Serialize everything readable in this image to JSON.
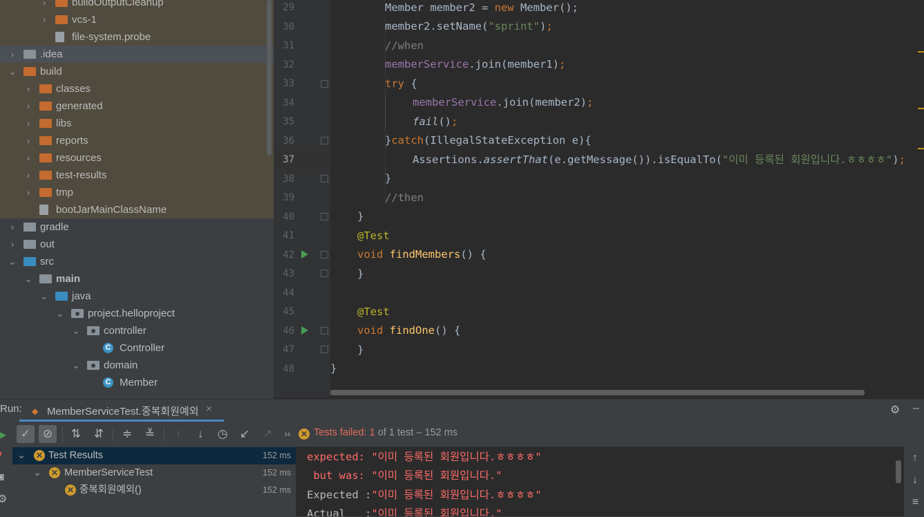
{
  "project_tree": {
    "items": [
      {
        "label": "buildOutputCleanup",
        "arrow": "›",
        "icon": "folder-orange"
      },
      {
        "label": "vcs-1",
        "arrow": "›",
        "icon": "folder-orange"
      },
      {
        "label": "file-system.probe",
        "arrow": "",
        "icon": "file"
      },
      {
        "label": ".idea",
        "arrow": "›",
        "icon": "folder-grey"
      },
      {
        "label": "build",
        "arrow": "⌄",
        "icon": "folder-orange"
      },
      {
        "label": "classes",
        "arrow": "›",
        "icon": "folder-orange"
      },
      {
        "label": "generated",
        "arrow": "›",
        "icon": "folder-orange"
      },
      {
        "label": "libs",
        "arrow": "›",
        "icon": "folder-orange"
      },
      {
        "label": "reports",
        "arrow": "›",
        "icon": "folder-orange"
      },
      {
        "label": "resources",
        "arrow": "›",
        "icon": "folder-orange"
      },
      {
        "label": "test-results",
        "arrow": "›",
        "icon": "folder-orange"
      },
      {
        "label": "tmp",
        "arrow": "›",
        "icon": "folder-orange"
      },
      {
        "label": "bootJarMainClassName",
        "arrow": "",
        "icon": "file"
      },
      {
        "label": "gradle",
        "arrow": "›",
        "icon": "folder-grey"
      },
      {
        "label": "out",
        "arrow": "›",
        "icon": "folder-grey"
      },
      {
        "label": "src",
        "arrow": "⌄",
        "icon": "folder-blue"
      },
      {
        "label": "main",
        "arrow": "⌄",
        "icon": "folder-grey"
      },
      {
        "label": "java",
        "arrow": "⌄",
        "icon": "folder-blue"
      },
      {
        "label": "project.helloproject",
        "arrow": "⌄",
        "icon": "package"
      },
      {
        "label": "controller",
        "arrow": "⌄",
        "icon": "package"
      },
      {
        "label": "Controller",
        "arrow": "",
        "icon": "class"
      },
      {
        "label": "domain",
        "arrow": "⌄",
        "icon": "package"
      },
      {
        "label": "Member",
        "arrow": "",
        "icon": "class"
      }
    ]
  },
  "editor": {
    "line_numbers": [
      "29",
      "30",
      "31",
      "32",
      "33",
      "34",
      "35",
      "36",
      "37",
      "38",
      "39",
      "40",
      "41",
      "42",
      "43",
      "44",
      "45",
      "46",
      "47",
      "48"
    ],
    "current_line": "37"
  },
  "run_panel": {
    "label": "Run:",
    "tab_label": "MemberServiceTest.중복회원예외",
    "tab_close": "×",
    "status_failed": "Tests failed:",
    "status_count": "1",
    "status_rest": "of 1 test – 152 ms",
    "results": [
      {
        "label": "Test Results",
        "time": "152 ms"
      },
      {
        "label": "MemberServiceTest",
        "time": "152 ms"
      },
      {
        "label": "중복회원예외()",
        "time": "152 ms"
      }
    ],
    "output": [
      "expected: \"이미 등록된 회원입니다.ㅎㅎㅎㅎ\"",
      " but was: \"이미 등록된 회원입니다.\"",
      "Expected :\"이미 등록된 회원입니다.ㅎㅎㅎㅎ\"",
      "Actual   :\"이미 등록된 회원입니다.\""
    ]
  },
  "colors": {
    "keyword": "#cc7832",
    "string": "#6a8759",
    "comment": "#808080",
    "field": "#9876aa",
    "method": "#ffc66d",
    "annotation": "#bbb529",
    "error": "#ff6b68"
  }
}
